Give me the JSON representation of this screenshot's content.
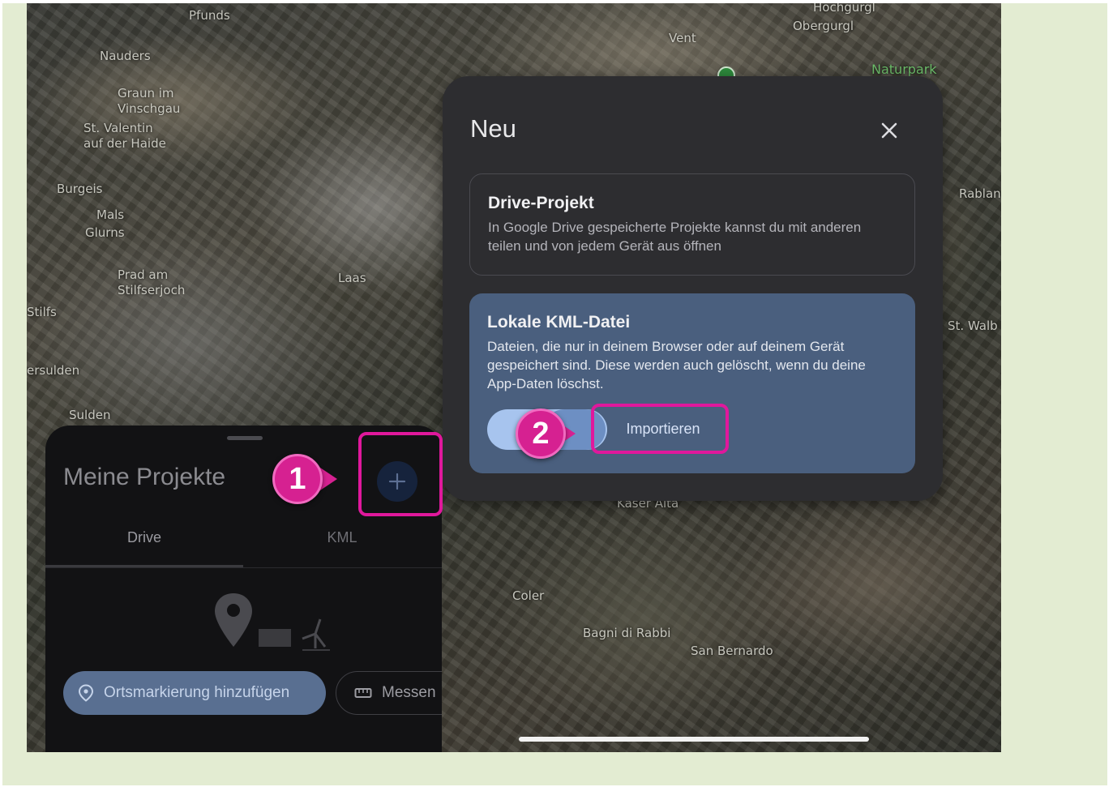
{
  "map": {
    "places": [
      "Pfunds",
      "Nauders",
      "Graun im\nVinschgau",
      "St. Valentin\nauf der Haide",
      "Burgeis",
      "Mals",
      "Glurns",
      "Prad am\nStilfserjoch",
      "Laas",
      "Stilfs",
      "ersulden",
      "Sulden",
      "Vent",
      "Hochgurgl",
      "Obergurgl",
      "Naturpark",
      "Rabland",
      "St. Walb",
      "Kaser Alta",
      "Coler",
      "Bagni di Rabbi",
      "San Bernardo"
    ]
  },
  "dialog": {
    "title": "Neu",
    "close_icon": "close-icon",
    "drive_card": {
      "title": "Drive-Projekt",
      "description": "In Google Drive gespeicherte Projekte kannst du mit anderen teilen und von jedem Gerät aus öffnen"
    },
    "kml_card": {
      "title": "Lokale KML-Datei",
      "description": "Dateien, die nur in deinem Browser oder auf deinem Gerät gespeichert sind. Diese werden auch gelöscht, wenn du deine App-Daten löschst.",
      "import_label": "Importieren"
    }
  },
  "panel": {
    "title": "Meine Projekte",
    "tabs": [
      {
        "label": "Drive",
        "active": true
      },
      {
        "label": "KML",
        "active": false
      }
    ],
    "add_placemark_label": "Ortsmarkierung hinzufügen",
    "measure_label": "Messen"
  },
  "annotations": {
    "step1": "1",
    "step2": "2"
  },
  "colors": {
    "highlight": "#e0189c",
    "kml_card_bg": "#4a5f7e",
    "chip_bg": "#596f91"
  }
}
